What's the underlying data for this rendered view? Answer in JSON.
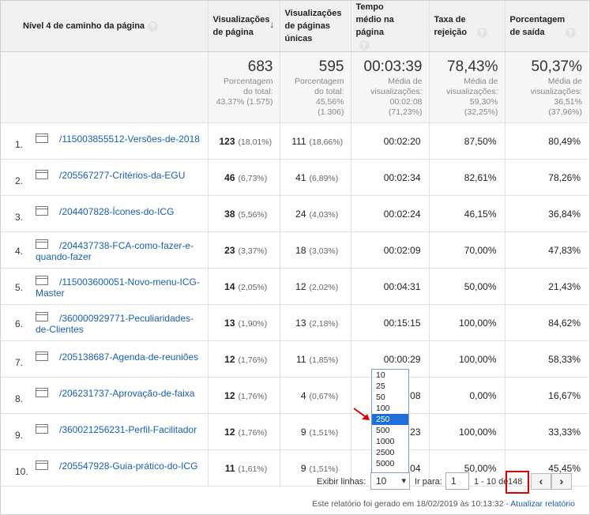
{
  "header": {
    "dimension": "Nível 4 de caminho da página",
    "col1": "Visualizações de página",
    "col2": "Visualizações de páginas únicas",
    "col3": "Tempo médio na página",
    "col4": "Taxa de rejeição",
    "col5": "Porcentagem de saída",
    "help_symbol": "?",
    "sort_symbol": "↓"
  },
  "summary": {
    "c1_big": "683",
    "c1_small": [
      "Porcentagem",
      "do total:",
      "43,37% (1.575)"
    ],
    "c2_big": "595",
    "c2_small": [
      "Porcentagem",
      "do total:",
      "45,56%",
      "(1.306)"
    ],
    "c3_big": "00:03:39",
    "c3_small": [
      "Média de",
      "visualizações:",
      "00:02:08",
      "(71,23%)"
    ],
    "c4_big": "78,43%",
    "c4_small": [
      "Média de",
      "visualizações:",
      "59,30%",
      "(32,25%)"
    ],
    "c5_big": "50,37%",
    "c5_small": [
      "Média de",
      "visualizações:",
      "36,51%",
      "(37,96%)"
    ]
  },
  "rows": [
    {
      "idx": "1.",
      "page": "/115003855512-Versões-de-2018",
      "pv": "123",
      "pvp": "(18,01%)",
      "upv": "111",
      "upvp": "(18,66%)",
      "time": "00:02:20",
      "bounce": "87,50%",
      "exit": "80,49%"
    },
    {
      "idx": "2.",
      "page": "/205567277-Critérios-da-EGU",
      "pv": "46",
      "pvp": "(6,73%)",
      "upv": "41",
      "upvp": "(6,89%)",
      "time": "00:02:34",
      "bounce": "82,61%",
      "exit": "78,26%"
    },
    {
      "idx": "3.",
      "page": "/204407828-Ícones-do-ICG",
      "pv": "38",
      "pvp": "(5,56%)",
      "upv": "24",
      "upvp": "(4,03%)",
      "time": "00:02:24",
      "bounce": "46,15%",
      "exit": "36,84%"
    },
    {
      "idx": "4.",
      "page": "/204437738-FCA-como-fazer-e-quando-fazer",
      "pv": "23",
      "pvp": "(3,37%)",
      "upv": "18",
      "upvp": "(3,03%)",
      "time": "00:02:09",
      "bounce": "70,00%",
      "exit": "47,83%"
    },
    {
      "idx": "5.",
      "page": "/115003600051-Novo-menu-ICG-Master",
      "pv": "14",
      "pvp": "(2,05%)",
      "upv": "12",
      "upvp": "(2,02%)",
      "time": "00:04:31",
      "bounce": "50,00%",
      "exit": "21,43%"
    },
    {
      "idx": "6.",
      "page": "/360000929771-Peculiaridades-de-Clientes",
      "pv": "13",
      "pvp": "(1,90%)",
      "upv": "13",
      "upvp": "(2,18%)",
      "time": "00:15:15",
      "bounce": "100,00%",
      "exit": "84,62%"
    },
    {
      "idx": "7.",
      "page": "/205138687-Agenda-de-reuniões",
      "pv": "12",
      "pvp": "(1,76%)",
      "upv": "11",
      "upvp": "(1,85%)",
      "time": "00:00:29",
      "bounce": "100,00%",
      "exit": "58,33%"
    },
    {
      "idx": "8.",
      "page": "/206231737-Aprovação-de-faixa",
      "pv": "12",
      "pvp": "(1,76%)",
      "upv": "4",
      "upvp": "(0,67%)",
      "time": ":08",
      "bounce": "0,00%",
      "exit": "16,67%"
    },
    {
      "idx": "9.",
      "page": "/360021256231-Perfil-Facilitador",
      "pv": "12",
      "pvp": "(1,76%)",
      "upv": "9",
      "upvp": "(1,51%)",
      "time": ":23",
      "bounce": "100,00%",
      "exit": "33,33%"
    },
    {
      "idx": "10.",
      "page": "/205547928-Guia-prático-do-ICG",
      "pv": "11",
      "pvp": "(1,61%)",
      "upv": "9",
      "upvp": "(1,51%)",
      "time": ":04",
      "bounce": "50,00%",
      "exit": "45,45%"
    }
  ],
  "pagination": {
    "rows_label": "Exibir linhas:",
    "rows_value": "10",
    "goto_label": "Ir para:",
    "goto_value": "1",
    "range_text": "1 - 10 de",
    "total": "148",
    "prev": "‹",
    "next": "›",
    "options": [
      "10",
      "25",
      "50",
      "100",
      "250",
      "500",
      "1000",
      "2500",
      "5000"
    ],
    "highlighted_option": "250"
  },
  "generated": {
    "text": "Este relatório foi gerado em 18/02/2019 às 10:13:32 - ",
    "link": "Atualizar relatório"
  },
  "colors": {
    "link": "#1a5fb4",
    "highlight_option": "#1e6fd9",
    "annotation_red": "#e00000"
  }
}
